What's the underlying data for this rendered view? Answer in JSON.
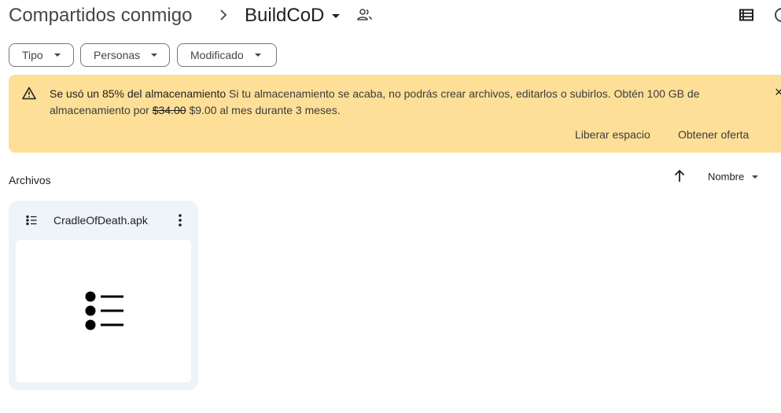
{
  "header": {
    "breadcrumb_root": "Compartidos conmigo",
    "folder_name": "BuildCoD",
    "icons": {
      "separator": "chevron-right-icon",
      "folder_menu": "caret-down-icon",
      "shared": "people-icon",
      "view": "list-view-icon",
      "info": "info-icon"
    }
  },
  "filters": {
    "type_label": "Tipo",
    "people_label": "Personas",
    "modified_label": "Modificado"
  },
  "banner": {
    "bold_text": "Se usó un 85% del almacenamiento",
    "text_1": " Si tu almacenamiento se acaba, no podrás crear archivos, editarlos o subirlos. Obtén 100 GB de almacenamiento por ",
    "old_price": "$34.00",
    "text_2": " $9.00 al mes durante 3 meses.",
    "free_space_label": "Liberar espacio",
    "get_offer_label": "Obtener oferta",
    "close_glyph": "×",
    "background_color": "#fedf98"
  },
  "section": {
    "title": "Archivos",
    "sort_label": "Nombre",
    "sort_direction": "ascending"
  },
  "files": [
    {
      "name": "CradleOfDeath.apk",
      "icon": "list-bullets-icon"
    }
  ]
}
